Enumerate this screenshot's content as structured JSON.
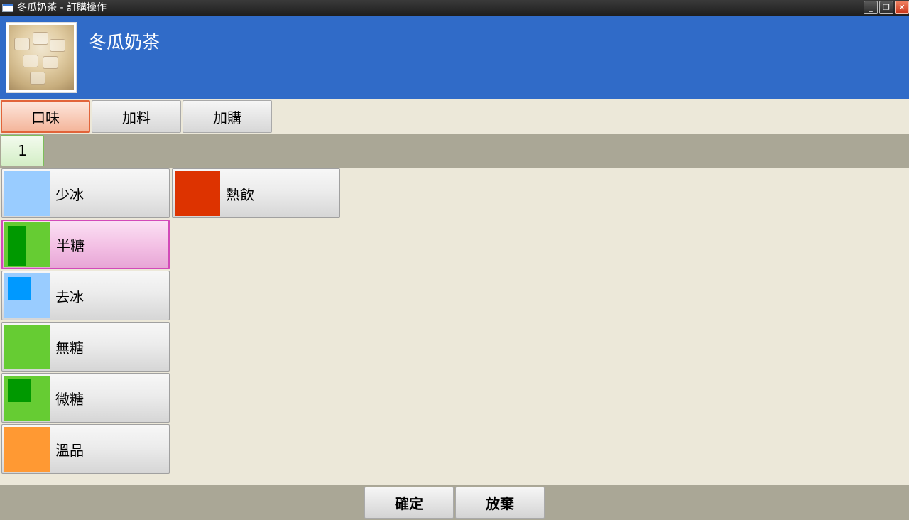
{
  "window": {
    "title": "冬瓜奶茶 - 訂購操作",
    "minimize_label": "_",
    "restore_label": "❐",
    "close_label": "✕"
  },
  "header": {
    "product_name": "冬瓜奶茶",
    "accent_color": "#306bc8"
  },
  "tabs": [
    {
      "label": "口味",
      "active": true
    },
    {
      "label": "加料",
      "active": false
    },
    {
      "label": "加購",
      "active": false
    }
  ],
  "pagination": {
    "current_page": "1"
  },
  "options": [
    {
      "label": "少冰",
      "color": "#99ccff",
      "selected": false
    },
    {
      "label": "熱飲",
      "color": "#dd3300",
      "selected": false
    },
    {
      "label": "半糖",
      "color": "#66cc33",
      "mark_color": "#009900",
      "selected": true
    },
    {
      "label": "去冰",
      "color": "#99ccff",
      "mark_color": "#0099ff",
      "selected": false
    },
    {
      "label": "無糖",
      "color": "#66cc33",
      "selected": false
    },
    {
      "label": "微糖",
      "color": "#66cc33",
      "mark_color": "#009900",
      "selected": false
    },
    {
      "label": "溫品",
      "color": "#ff9933",
      "selected": false
    }
  ],
  "footer": {
    "confirm_label": "確定",
    "cancel_label": "放棄"
  }
}
